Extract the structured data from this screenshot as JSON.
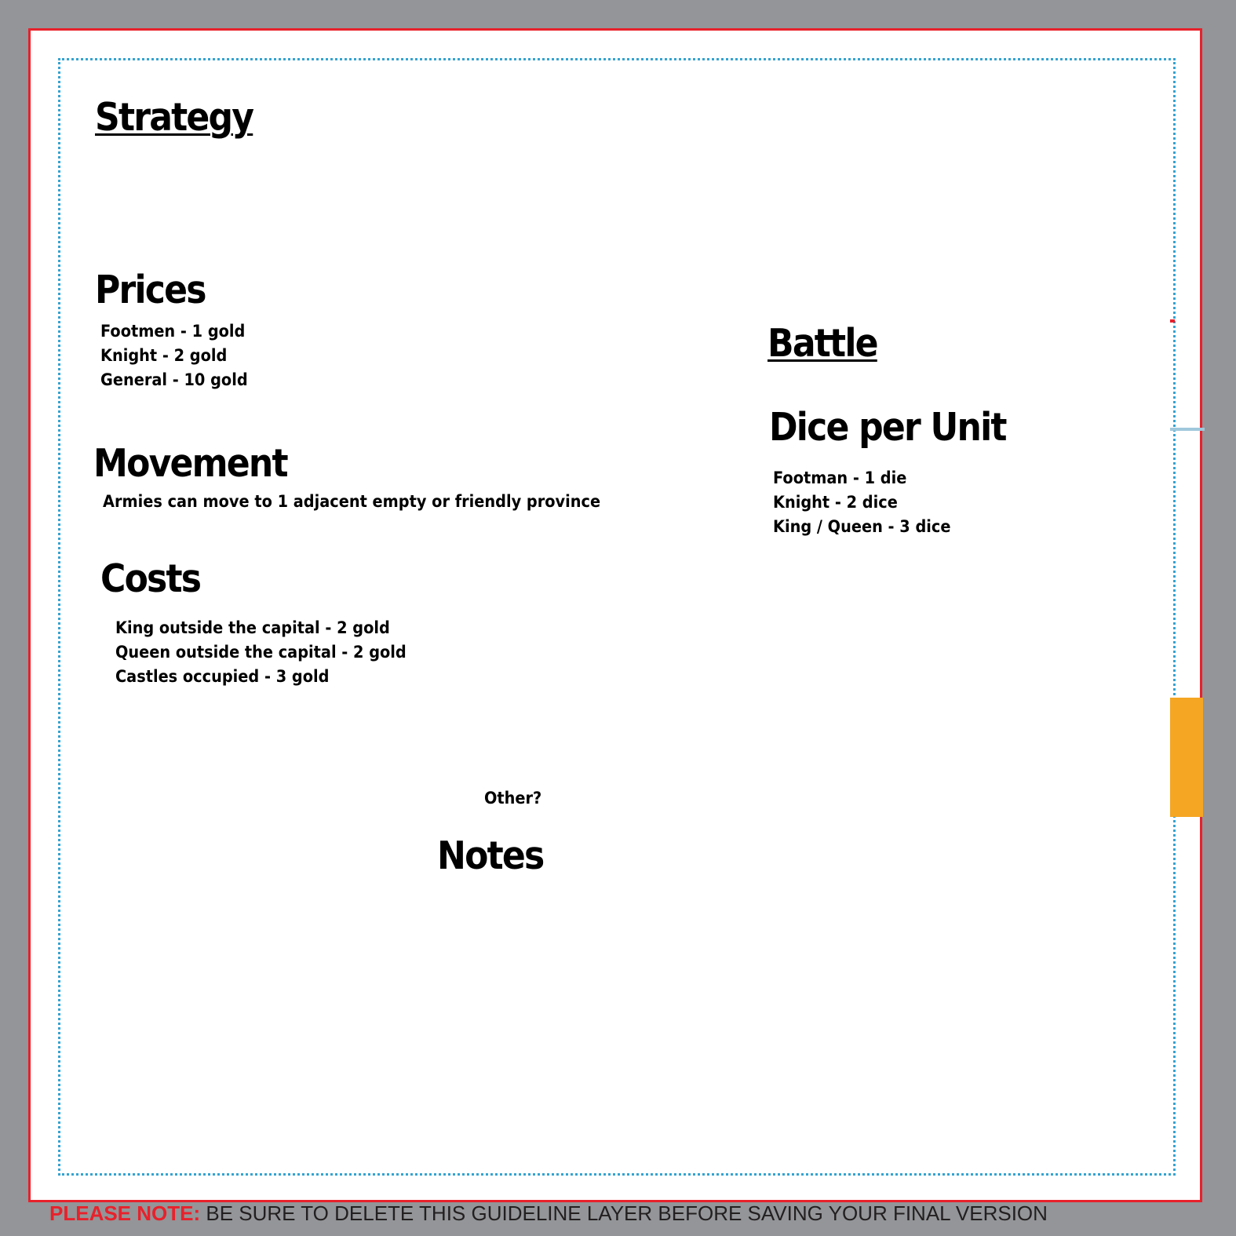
{
  "strategy": {
    "title": "Strategy"
  },
  "prices": {
    "title": "Prices",
    "items": [
      "Footmen - 1 gold",
      "Knight - 2 gold",
      "General - 10 gold"
    ]
  },
  "movement": {
    "title": "Movement",
    "text": "Armies can move to 1 adjacent empty or friendly province"
  },
  "costs": {
    "title": "Costs",
    "items": [
      "King outside the capital - 2 gold",
      "Queen outside the capital - 2 gold",
      "Castles occupied - 3 gold"
    ]
  },
  "battle": {
    "title": "Battle"
  },
  "dice": {
    "title": "Dice per Unit",
    "items": [
      "Footman - 1 die",
      "Knight - 2 dice",
      "King / Queen - 3 dice"
    ]
  },
  "other": {
    "label": "Other?"
  },
  "notes": {
    "title": "Notes"
  },
  "guideline": {
    "label": "PLEASE NOTE:",
    "text": "BE SURE TO DELETE THIS GUIDELINE LAYER BEFORE SAVING YOUR FINAL VERSION"
  },
  "colors": {
    "bleed_line": "#e8212b",
    "safe_line": "#33a3d1",
    "background": "#939598",
    "marker": "#f5a623"
  }
}
